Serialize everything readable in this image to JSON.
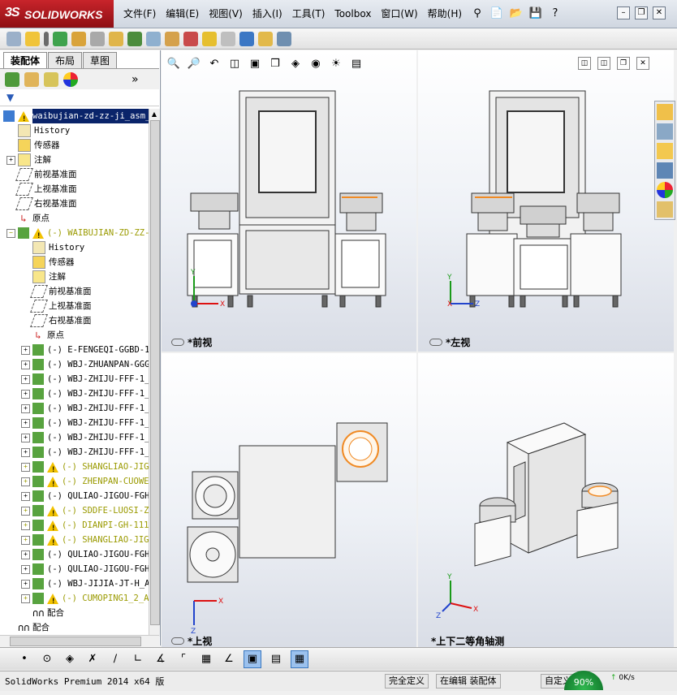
{
  "app": {
    "brand_ds": "3S",
    "brand_name": "SOLIDWORKS",
    "menu": [
      "文件(F)",
      "编辑(E)",
      "视图(V)",
      "插入(I)",
      "工具(T)",
      "Toolbox",
      "窗口(W)",
      "帮助(H)"
    ],
    "help_glyph": "?"
  },
  "panel": {
    "tabs": [
      "装配体",
      "布局",
      "草图"
    ],
    "active_tab": "装配体"
  },
  "tree": {
    "root": "waibujian-zd-zz-ji_asm_",
    "top_items": [
      "History",
      "传感器",
      "注解",
      "前视基准面",
      "上视基准面",
      "右视基准面",
      "原点"
    ],
    "sub_assembly": "(-) WAIBUJIAN-ZD-ZZ-J",
    "sub_items": [
      "History",
      "传感器",
      "注解",
      "前视基准面",
      "上视基准面",
      "右视基准面",
      "原点"
    ],
    "components": [
      {
        "label": "(-) E-FENGEQI-GGBD-1",
        "warn": false
      },
      {
        "label": "(-) WBJ-ZHUANPAN-GGG",
        "warn": false
      },
      {
        "label": "(-) WBJ-ZHIJU-FFF-1_",
        "warn": false
      },
      {
        "label": "(-) WBJ-ZHIJU-FFF-1_",
        "warn": false
      },
      {
        "label": "(-) WBJ-ZHIJU-FFF-1_",
        "warn": false
      },
      {
        "label": "(-) WBJ-ZHIJU-FFF-1_",
        "warn": false
      },
      {
        "label": "(-) WBJ-ZHIJU-FFF-1_",
        "warn": false
      },
      {
        "label": "(-) WBJ-ZHIJU-FFF-1_",
        "warn": false
      },
      {
        "label": "(-) SHANGLIAO-JIG",
        "warn": true
      },
      {
        "label": "(-) ZHENPAN-CUOWE",
        "warn": true
      },
      {
        "label": "(-) QULIAO-JIGOU-FGH",
        "warn": false
      },
      {
        "label": "(-) SDDFE-LUOSI-Z",
        "warn": true
      },
      {
        "label": "(-) DIANPI-GH-111",
        "warn": true
      },
      {
        "label": "(-) SHANGLIAO-JIG",
        "warn": true
      },
      {
        "label": "(-) QULIAO-JIGOU-FGH",
        "warn": false
      },
      {
        "label": "(-) QULIAO-JIGOU-FGH",
        "warn": false
      },
      {
        "label": "(-) WBJ-JIJIA-JT-H_A",
        "warn": false
      },
      {
        "label": "(-) CUMOPING1_2_A",
        "warn": true
      }
    ],
    "mates_sub": "配合",
    "mates_root": "配合"
  },
  "views": {
    "front": "*前视",
    "left": "*左视",
    "top": "*上视",
    "iso": "*上下二等角轴测"
  },
  "status": {
    "product": "SolidWorks Premium 2014 x64 版",
    "defined": "完全定义",
    "editing": "在编辑 装配体",
    "custom": "自定义",
    "net_percent": "90%",
    "net_speed": "0K/s"
  },
  "colors": {
    "brand_red": "#c8242b",
    "selection": "#0a246a",
    "warning": "#f2c200",
    "accent_orange": "#f08a24"
  }
}
